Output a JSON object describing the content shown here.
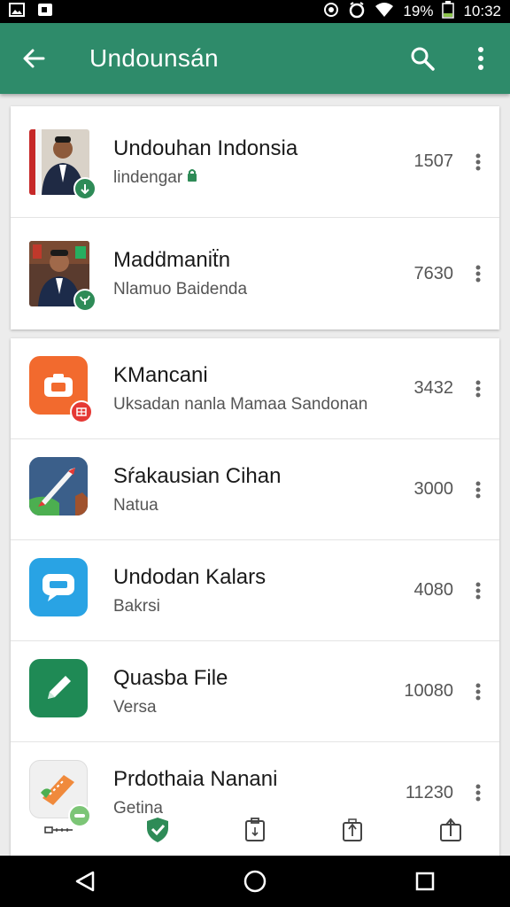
{
  "status": {
    "battery": "19%",
    "time": "10:32"
  },
  "app_bar": {
    "title": "Undounsán"
  },
  "top_list": [
    {
      "title": "Undouhan Indonsia",
      "subtitle": "lindengar",
      "count": "1507",
      "badge_color": "#2e8b57"
    },
    {
      "title": "Madḋmaniẗn",
      "subtitle": "Nlamuo Baidenda",
      "count": "7630",
      "badge_color": "#2e8b57"
    }
  ],
  "bottom_list": [
    {
      "title": "KMancani",
      "subtitle": "Uksadan nanla Mamaa Sandonan",
      "count": "3432",
      "tile_color": "#f26a2e",
      "badge_color": "#e53935"
    },
    {
      "title": "Sŕakausian Cihan",
      "subtitle": "Natua",
      "count": "3000",
      "tile_color": "#2d4f7c"
    },
    {
      "title": "Undodan Kalars",
      "subtitle": "Bakrsi",
      "count": "4080",
      "tile_color": "#29a3e4"
    },
    {
      "title": "Quasba File",
      "subtitle": "Versa",
      "count": "10080",
      "tile_color": "#1f8a55"
    },
    {
      "title": "Prdothaia Nanani",
      "subtitle": "Getina",
      "count": "11230",
      "tile_color": "#f0f0f0"
    }
  ],
  "colors": {
    "primary": "#2e8b6a",
    "nav_active": "#2e8b57"
  },
  "icons": [
    "back-arrow-icon",
    "search-icon",
    "more-vert-icon",
    "shield-icon",
    "clipboard-icon",
    "share-icon",
    "upload-icon"
  ]
}
